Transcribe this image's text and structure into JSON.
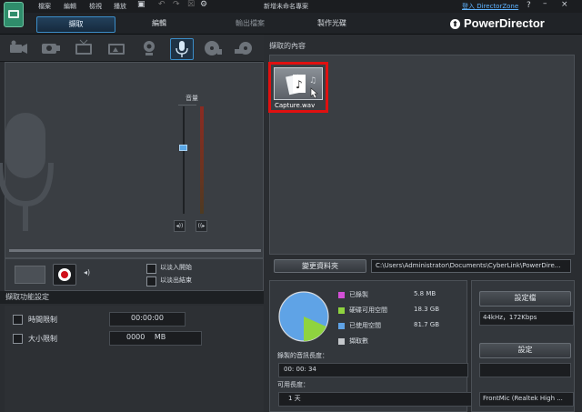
{
  "menu": {
    "file": "檔案",
    "edit": "編輯",
    "view": "檢視",
    "play": "播放"
  },
  "window": {
    "title": "新增未命名專案",
    "login": "登入 DirectorZone",
    "help": "?",
    "min": "–",
    "close": "×"
  },
  "tabs": {
    "capture": "擷取",
    "edit": "編輯",
    "output": "輸出檔案",
    "disc": "製作光碟"
  },
  "brand": {
    "name": "PowerDirector"
  },
  "capture": {
    "volume_label": "音量",
    "fade_in": "以淡入開始",
    "fade_out": "以淡出結束",
    "settings_header": "擷取功能設定",
    "time_limit_label": "時間限制",
    "time_limit_value": "00:00:00",
    "size_limit_label": "大小限制",
    "size_limit_value": "0000",
    "size_unit": "MB"
  },
  "captured": {
    "header": "擷取的內容",
    "file_name": "Capture.wav"
  },
  "folder": {
    "change_button": "變更資料夾",
    "path": "C:\\Users\\Administrator\\Documents\\CyberLink\\PowerDire..."
  },
  "storage": {
    "items": [
      {
        "label": "已錄製",
        "value": "5.8 MB",
        "color": "#d34fd6"
      },
      {
        "label": "硬碟可用空間",
        "value": "18.3 GB",
        "color": "#8fd33f"
      },
      {
        "label": "已使用空間",
        "value": "81.7 GB",
        "color": "#5fa3e6"
      },
      {
        "label": "擷取數",
        "value": "",
        "color": "#c4c7cb"
      }
    ],
    "used_fraction": 0.817,
    "free_fraction": 0.183,
    "recorded_length_label": "錄製的音訊長度：",
    "recorded_length_value": "00: 00: 34",
    "available_length_label": "可用長度：",
    "available_length_value": "1 天"
  },
  "profile": {
    "button": "設定檔",
    "value": "44kHz，172Kbps",
    "settings_button": "設定",
    "settings_value": "",
    "device": "FrontMic (Realtek High ..."
  },
  "colors": {
    "accent": "#3b8dc8",
    "highlight_red": "#e01010",
    "record_red": "#d0101a"
  }
}
